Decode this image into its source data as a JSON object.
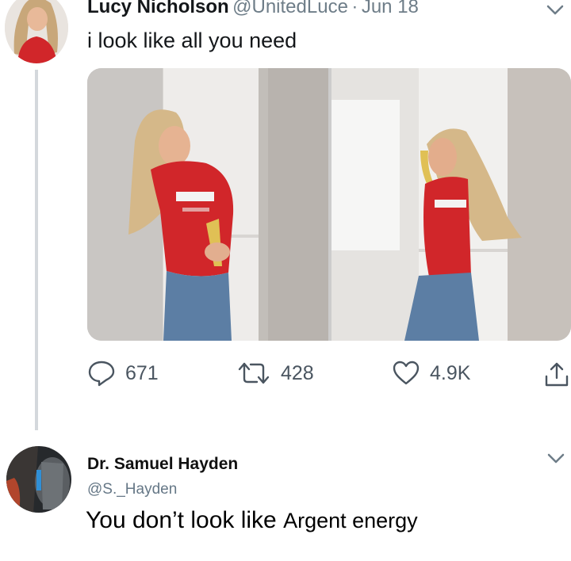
{
  "tweet": {
    "author_name": "Lucy Nicholson",
    "handle": "@UnitedLuce",
    "separator": "·",
    "date": "Jun 18",
    "text": "i look like all you need",
    "actions": {
      "reply_count": "671",
      "retweet_count": "428",
      "like_count": "4.9K"
    }
  },
  "reply": {
    "author_name": "Dr. Samuel Hayden",
    "handle": "@S._Hayden",
    "text_part1": "You don’t look like",
    "text_part2": "Argent energy"
  },
  "colors": {
    "jersey_red": "#d1262a",
    "handle_gray": "#6e7d88",
    "thread_line": "#d4d8dc"
  },
  "icons": [
    "chevron-down-icon",
    "reply-icon",
    "retweet-icon",
    "like-icon",
    "share-icon"
  ]
}
